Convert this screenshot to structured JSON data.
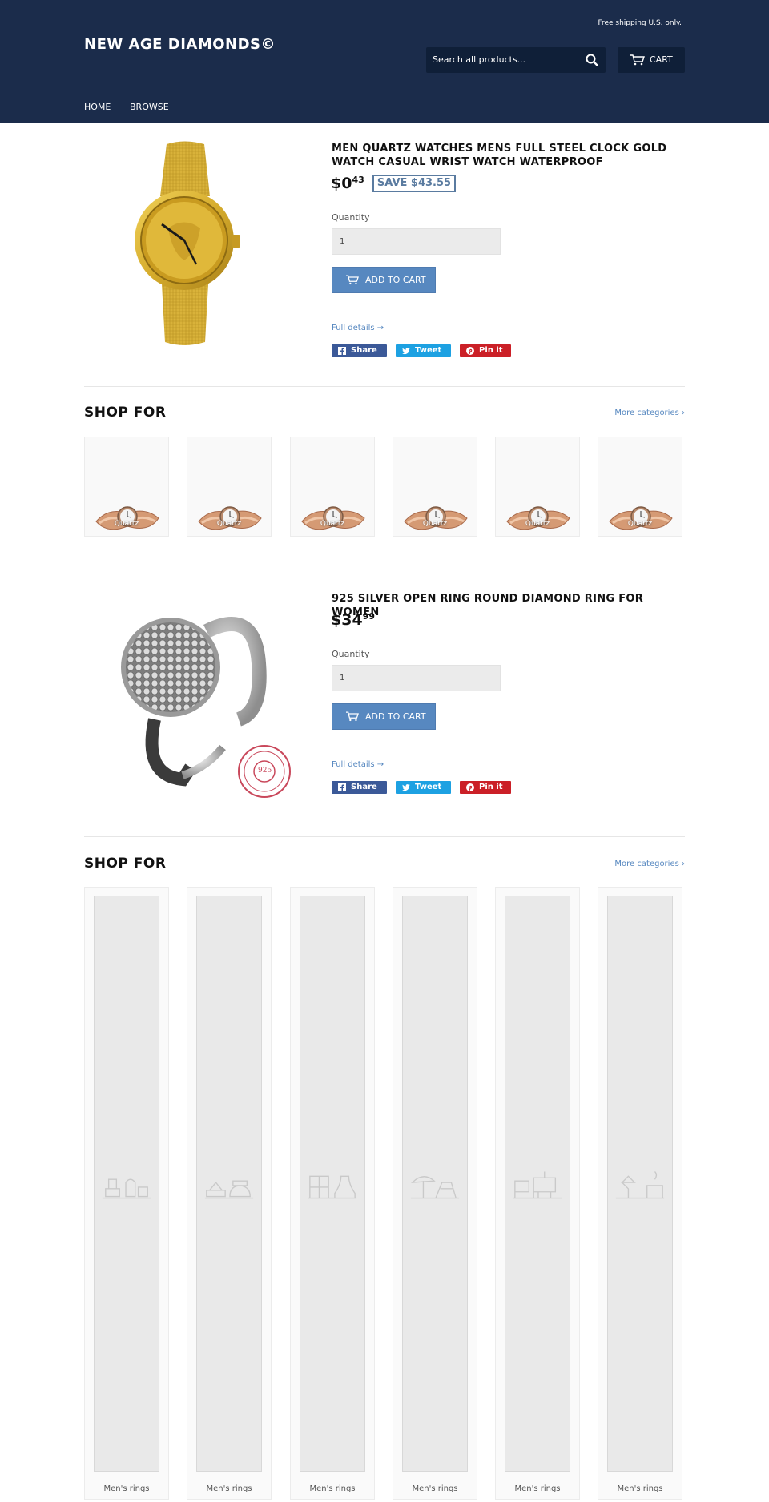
{
  "header": {
    "shipping_note": "Free shipping U.S. only.",
    "logo": "NEW AGE DIAMONDS©",
    "search_placeholder": "Search all products...",
    "cart_label": "CART",
    "nav": [
      "HOME",
      "BROWSE"
    ]
  },
  "products": [
    {
      "title": "MEN QUARTZ WATCHES MENS FULL STEEL CLOCK GOLD WATCH CASUAL WRIST WATCH WATERPROOF",
      "price_main": "$0",
      "price_cents": "43",
      "save_badge": "SAVE $43.55",
      "quantity_label": "Quantity",
      "quantity_value": "1",
      "add_to_cart": "ADD TO CART",
      "full_details": "Full details →",
      "share_labels": [
        "Share",
        "Tweet",
        "Pin it"
      ]
    },
    {
      "title": "925 SILVER OPEN RING ROUND DIAMOND RING FOR WOMEN",
      "price_main": "$34",
      "price_cents": "99",
      "quantity_label": "Quantity",
      "quantity_value": "1",
      "add_to_cart": "ADD TO CART",
      "full_details": "Full details →",
      "share_labels": [
        "Share",
        "Tweet",
        "Pin it"
      ],
      "stamp_text": "925"
    }
  ],
  "shop_sections": [
    {
      "title": "SHOP FOR",
      "more_link": "More categories ›",
      "cards": [
        "Quartz",
        "Quartz",
        "Quartz",
        "Quartz",
        "Quartz",
        "Quartz"
      ]
    },
    {
      "title": "SHOP FOR",
      "more_link": "More categories ›",
      "cards": [
        "Men's rings",
        "Men's rings",
        "Men's rings",
        "Men's rings",
        "Men's rings",
        "Men's rings"
      ]
    }
  ],
  "colors": {
    "header_bg": "#1b2c4b",
    "accent": "#5788c0",
    "facebook": "#3b5998",
    "twitter": "#1da1e2",
    "pinterest": "#cb2027"
  },
  "icons": [
    "search-icon",
    "cart-icon",
    "facebook-icon",
    "twitter-icon",
    "pinterest-icon"
  ]
}
